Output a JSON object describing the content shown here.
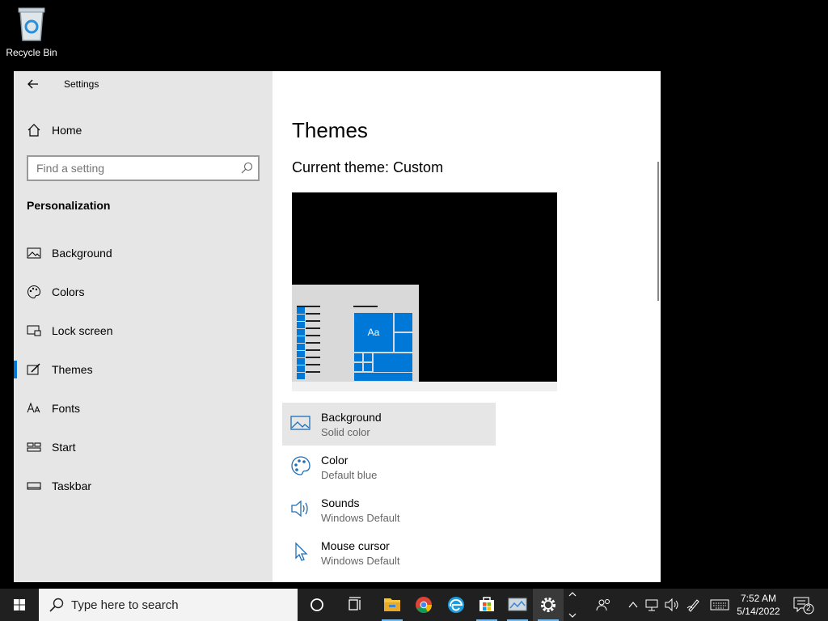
{
  "desktop": {
    "recycle_bin_label": "Recycle Bin"
  },
  "window": {
    "title": "Settings",
    "sidebar": {
      "home_label": "Home",
      "search_placeholder": "Find a setting",
      "section_title": "Personalization",
      "items": [
        {
          "label": "Background",
          "icon": "picture-icon"
        },
        {
          "label": "Colors",
          "icon": "palette-icon"
        },
        {
          "label": "Lock screen",
          "icon": "lock-screen-icon"
        },
        {
          "label": "Themes",
          "icon": "themes-icon",
          "active": true
        },
        {
          "label": "Fonts",
          "icon": "fonts-icon"
        },
        {
          "label": "Start",
          "icon": "start-icon"
        },
        {
          "label": "Taskbar",
          "icon": "taskbar-icon"
        }
      ]
    },
    "main": {
      "page_title": "Themes",
      "current_theme": "Current theme: Custom",
      "preview_tile_label": "Aa",
      "options": [
        {
          "title": "Background",
          "subtitle": "Solid color",
          "icon": "picture-icon"
        },
        {
          "title": "Color",
          "subtitle": "Default blue",
          "icon": "palette-icon"
        },
        {
          "title": "Sounds",
          "subtitle": "Windows Default",
          "icon": "speaker-icon"
        },
        {
          "title": "Mouse cursor",
          "subtitle": "Windows Default",
          "icon": "cursor-icon"
        }
      ]
    }
  },
  "taskbar": {
    "search_placeholder": "Type here to search",
    "time": "7:52 AM",
    "date": "5/14/2022",
    "notification_count": "2"
  },
  "colors": {
    "accent": "#0078d7",
    "taskbar": "#202020",
    "sidebar": "#e6e6e6"
  }
}
